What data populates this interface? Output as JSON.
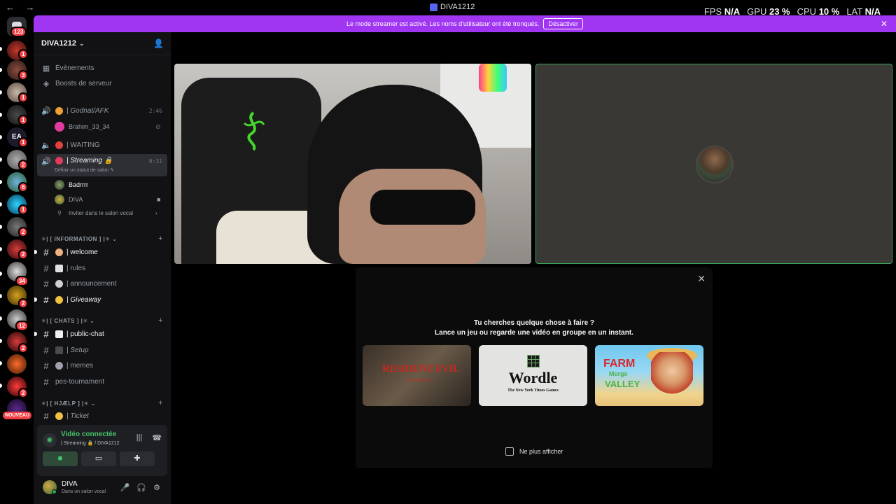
{
  "titlebar": {
    "title": "DIVA1212",
    "arrows": "← →"
  },
  "perf": {
    "fps_label": "FPS",
    "fps_value": "N/A",
    "gpu_label": "GPU",
    "gpu_value": "23 %",
    "cpu_label": "CPU",
    "cpu_value": "10 %",
    "lat_label": "LAT",
    "lat_value": "N/A"
  },
  "rail": {
    "home_badge": "123",
    "badges": [
      "1",
      "3",
      "1",
      "1",
      "1",
      "2",
      "6",
      "1",
      "2",
      "2",
      "34",
      "2",
      "12",
      "2",
      "2"
    ],
    "ea_label": "EA",
    "nouveau": "NOUVEAU"
  },
  "banner": {
    "text": "Le mode streamer est activé. Les noms d'utilisateur ont été tronqués.",
    "button": "Désactiver"
  },
  "server": {
    "name": "DIVA1212",
    "events": "Évènements",
    "boosts": "Boosts de serveur"
  },
  "voice_channels": {
    "afk_name": "| Godnat/AFK",
    "afk_time": "2:46",
    "afk_user": "Brahim_33_34",
    "waiting_name": "| WAITING",
    "streaming_name": "| Streaming 🔒",
    "streaming_time": "9:31",
    "streaming_status": "Définir un statut de salon ✎",
    "member1": "Badrrrr",
    "member2": "DIVA",
    "invite": "Inviter dans le salon vocal"
  },
  "categories": {
    "information": "✳| [ INFORMATION ] |✳",
    "chats": "✳| [ CHATS ] |✳",
    "help": "✳| [ HJÆLP ] |✳"
  },
  "text_channels": {
    "welcome": "| welcome",
    "rules": "| rules",
    "announcement": "| announcement",
    "giveaway": "| Giveaway",
    "public_chat": "| public-chat",
    "setup": "| Setup",
    "memes": "| memes",
    "pes": "pes-tournament",
    "ticket": "| Ticket"
  },
  "voice_panel": {
    "title": "Vidéo connectée",
    "subtitle": "| Streaming 🔒 / DIVA1212"
  },
  "user": {
    "name": "DIVA",
    "status": "Dans un salon vocal"
  },
  "activity": {
    "line1": "Tu cherches quelque chose à faire ?",
    "line2": "Lance un jeu ou regarde une vidéo en groupe en un instant.",
    "game1_title": "RESIDENT EVIL",
    "game1_sub": "SEPTEMBER 13",
    "game2_title": "Wordle",
    "game2_sub": "The New York Times Games",
    "game3_t1": "FARM",
    "game3_t2": "Merge",
    "game3_t3": "VALLEY",
    "checkbox": "Ne plus afficher"
  }
}
